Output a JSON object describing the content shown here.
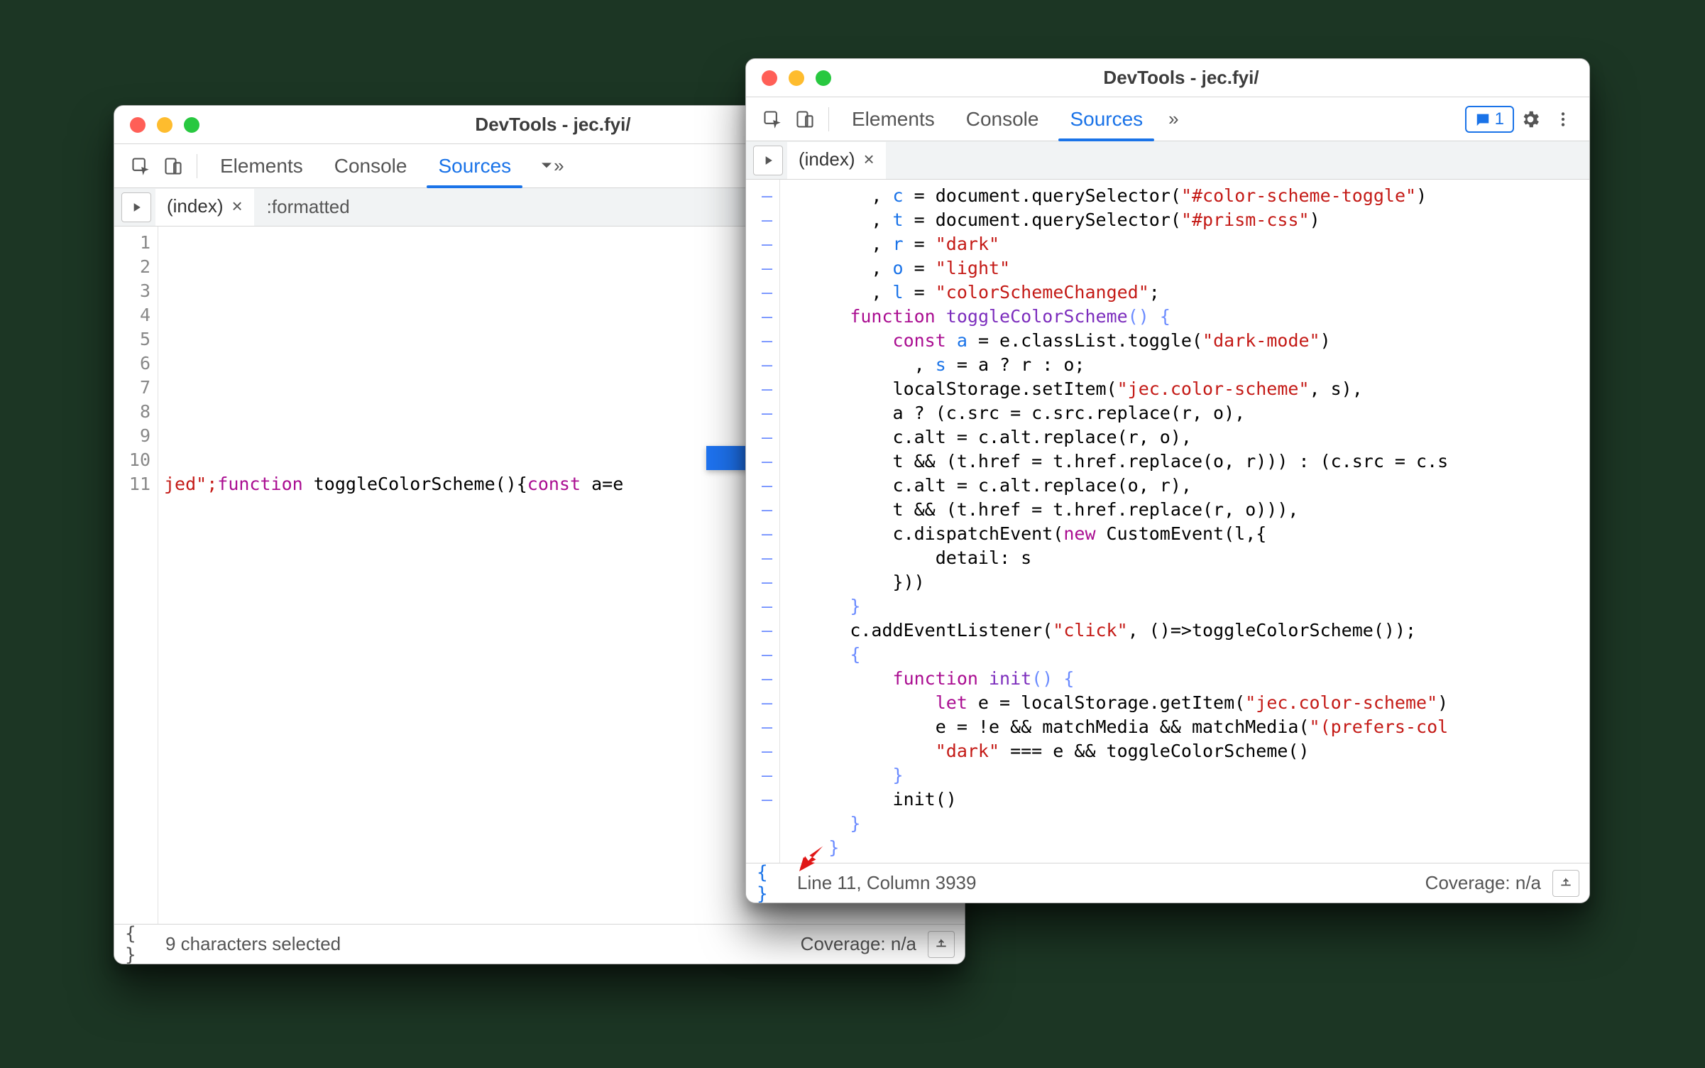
{
  "colors": {
    "traffic_red": "#ff5f57",
    "traffic_yellow": "#febc2e",
    "traffic_green": "#28c840",
    "accent_blue": "#1a73e8",
    "arrow_blue": "#1e73f0",
    "arrow_red": "#e01616"
  },
  "left_window": {
    "title": "DevTools - jec.fyi/",
    "tabs": [
      "Elements",
      "Console",
      "Sources"
    ],
    "active_tab_index": 2,
    "file_tabs": [
      {
        "name": "(index)",
        "active": true
      }
    ],
    "extra_filetab_label": ":formatted",
    "gutter_lines": [
      "1",
      "2",
      "3",
      "4",
      "5",
      "6",
      "7",
      "8",
      "9",
      "10",
      "11"
    ],
    "code_line11_prefix": "jed\";",
    "code_line11_kw1": "function",
    "code_line11_fn": "toggleColorScheme",
    "code_line11_paren": "(){",
    "code_line11_kw2": "const",
    "code_line11_tail": " a=e",
    "status_left": "9 characters selected",
    "status_right": "Coverage: n/a"
  },
  "right_window": {
    "title": "DevTools - jec.fyi/",
    "tabs": [
      "Elements",
      "Console",
      "Sources"
    ],
    "active_tab_index": 2,
    "issues_count": "1",
    "file_tabs": [
      {
        "name": "(index)",
        "active": true
      }
    ],
    "gutter_dash_count": 26,
    "code_lines": [
      {
        "indent": 8,
        "tokens": [
          {
            "t": ", ",
            "c": "punct"
          },
          {
            "t": "c",
            "c": "var"
          },
          {
            "t": " = document.querySelector(",
            "c": "obj"
          },
          {
            "t": "\"#color-scheme-toggle\"",
            "c": "str"
          },
          {
            "t": ")",
            "c": "obj"
          }
        ]
      },
      {
        "indent": 8,
        "tokens": [
          {
            "t": ", ",
            "c": "punct"
          },
          {
            "t": "t",
            "c": "var"
          },
          {
            "t": " = document.querySelector(",
            "c": "obj"
          },
          {
            "t": "\"#prism-css\"",
            "c": "str"
          },
          {
            "t": ")",
            "c": "obj"
          }
        ]
      },
      {
        "indent": 8,
        "tokens": [
          {
            "t": ", ",
            "c": "punct"
          },
          {
            "t": "r",
            "c": "var"
          },
          {
            "t": " = ",
            "c": "op"
          },
          {
            "t": "\"dark\"",
            "c": "str"
          }
        ]
      },
      {
        "indent": 8,
        "tokens": [
          {
            "t": ", ",
            "c": "punct"
          },
          {
            "t": "o",
            "c": "var"
          },
          {
            "t": " = ",
            "c": "op"
          },
          {
            "t": "\"light\"",
            "c": "str"
          }
        ]
      },
      {
        "indent": 8,
        "tokens": [
          {
            "t": ", ",
            "c": "punct"
          },
          {
            "t": "l",
            "c": "var"
          },
          {
            "t": " = ",
            "c": "op"
          },
          {
            "t": "\"colorSchemeChanged\"",
            "c": "str"
          },
          {
            "t": ";",
            "c": "punct"
          }
        ]
      },
      {
        "indent": 6,
        "tokens": [
          {
            "t": "function",
            "c": "kw"
          },
          {
            "t": " ",
            "c": "op"
          },
          {
            "t": "toggleColorScheme",
            "c": "prop"
          },
          {
            "t": "() {",
            "c": "brace"
          }
        ]
      },
      {
        "indent": 10,
        "tokens": [
          {
            "t": "const",
            "c": "kw"
          },
          {
            "t": " ",
            "c": "op"
          },
          {
            "t": "a",
            "c": "var"
          },
          {
            "t": " = e.classList.toggle(",
            "c": "obj"
          },
          {
            "t": "\"dark-mode\"",
            "c": "str"
          },
          {
            "t": ")",
            "c": "obj"
          }
        ]
      },
      {
        "indent": 12,
        "tokens": [
          {
            "t": ", ",
            "c": "punct"
          },
          {
            "t": "s",
            "c": "var"
          },
          {
            "t": " = a ? r : o;",
            "c": "obj"
          }
        ]
      },
      {
        "indent": 10,
        "tokens": [
          {
            "t": "localStorage.setItem(",
            "c": "obj"
          },
          {
            "t": "\"jec.color-scheme\"",
            "c": "str"
          },
          {
            "t": ", s),",
            "c": "obj"
          }
        ]
      },
      {
        "indent": 10,
        "tokens": [
          {
            "t": "a ? (c.src = c.src.replace(r, o),",
            "c": "obj"
          }
        ]
      },
      {
        "indent": 10,
        "tokens": [
          {
            "t": "c.alt = c.alt.replace(r, o),",
            "c": "obj"
          }
        ]
      },
      {
        "indent": 10,
        "tokens": [
          {
            "t": "t && (t.href = t.href.replace(o, r))) : (c.src = c.s",
            "c": "obj"
          }
        ]
      },
      {
        "indent": 10,
        "tokens": [
          {
            "t": "c.alt = c.alt.replace(o, r),",
            "c": "obj"
          }
        ]
      },
      {
        "indent": 10,
        "tokens": [
          {
            "t": "t && (t.href = t.href.replace(r, o))),",
            "c": "obj"
          }
        ]
      },
      {
        "indent": 10,
        "tokens": [
          {
            "t": "c.dispatchEvent(",
            "c": "obj"
          },
          {
            "t": "new",
            "c": "kw"
          },
          {
            "t": " CustomEvent(l,{",
            "c": "obj"
          }
        ]
      },
      {
        "indent": 14,
        "tokens": [
          {
            "t": "detail: s",
            "c": "obj"
          }
        ]
      },
      {
        "indent": 10,
        "tokens": [
          {
            "t": "}))",
            "c": "obj"
          }
        ]
      },
      {
        "indent": 6,
        "tokens": [
          {
            "t": "}",
            "c": "brace"
          }
        ]
      },
      {
        "indent": 6,
        "tokens": [
          {
            "t": "c.addEventListener(",
            "c": "obj"
          },
          {
            "t": "\"click\"",
            "c": "str"
          },
          {
            "t": ", ()=>toggleColorScheme());",
            "c": "obj"
          }
        ]
      },
      {
        "indent": 6,
        "tokens": [
          {
            "t": "{",
            "c": "brace"
          }
        ]
      },
      {
        "indent": 10,
        "tokens": [
          {
            "t": "function",
            "c": "kw"
          },
          {
            "t": " ",
            "c": "op"
          },
          {
            "t": "init",
            "c": "prop"
          },
          {
            "t": "() {",
            "c": "brace"
          }
        ]
      },
      {
        "indent": 14,
        "tokens": [
          {
            "t": "let",
            "c": "kw"
          },
          {
            "t": " e = localStorage.getItem(",
            "c": "obj"
          },
          {
            "t": "\"jec.color-scheme\"",
            "c": "str"
          },
          {
            "t": ")",
            "c": "obj"
          }
        ]
      },
      {
        "indent": 14,
        "tokens": [
          {
            "t": "e = !e && matchMedia && matchMedia(",
            "c": "obj"
          },
          {
            "t": "\"(prefers-col",
            "c": "str"
          }
        ]
      },
      {
        "indent": 14,
        "tokens": [
          {
            "t": "\"dark\"",
            "c": "str"
          },
          {
            "t": " === e && toggleColorScheme()",
            "c": "obj"
          }
        ]
      },
      {
        "indent": 10,
        "tokens": [
          {
            "t": "}",
            "c": "brace"
          }
        ]
      },
      {
        "indent": 10,
        "tokens": [
          {
            "t": "init()",
            "c": "obj"
          }
        ]
      },
      {
        "indent": 6,
        "tokens": [
          {
            "t": "}",
            "c": "brace"
          }
        ]
      },
      {
        "indent": 4,
        "tokens": [
          {
            "t": "}",
            "c": "brace"
          }
        ]
      }
    ],
    "status_left": "Line 11, Column 3939",
    "status_right": "Coverage: n/a"
  }
}
